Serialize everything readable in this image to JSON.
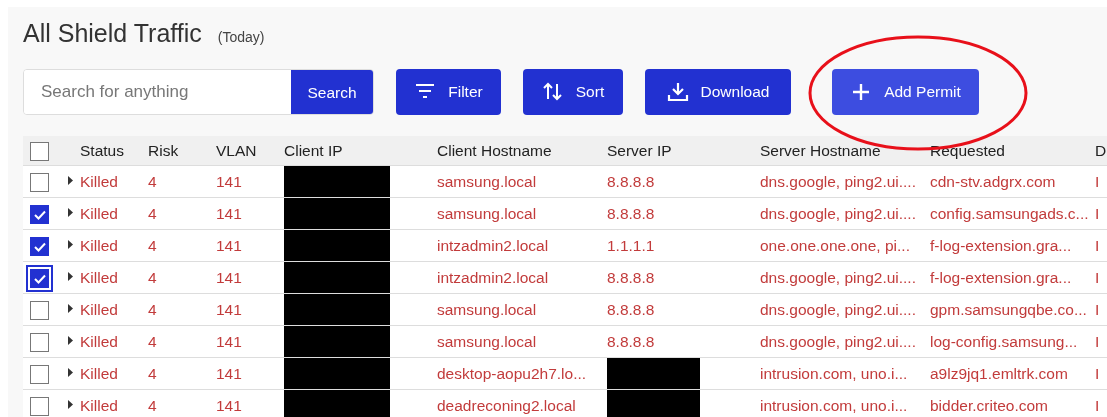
{
  "title": "All Shield Traffic",
  "subtitle": "(Today)",
  "search": {
    "placeholder": "Search for anything",
    "button": "Search"
  },
  "buttons": [
    {
      "label": "Filter",
      "kind": "filter",
      "hovered": false
    },
    {
      "label": "Sort",
      "kind": "sort",
      "hovered": false
    },
    {
      "label": "Download",
      "kind": "download",
      "hovered": false
    },
    {
      "label": "Add Permit",
      "kind": "add",
      "hovered": true
    }
  ],
  "annotation": {
    "kind": "ellipse",
    "color": "#e8101a"
  },
  "table": {
    "all_checked": false,
    "columns": [
      "Status",
      "Risk",
      "VLAN",
      "Client IP",
      "Client Hostname",
      "Server IP",
      "Server Hostname",
      "Requested",
      "D"
    ],
    "rows": [
      {
        "checked": false,
        "focused": false,
        "status": "Killed",
        "risk": "4",
        "vlan": "141",
        "client_ip_redacted": true,
        "client_hostname": "samsung.local",
        "server_ip": "8.8.8.8",
        "server_ip_redacted": false,
        "server_hostname": "dns.google, ping2.ui....",
        "requested": "cdn-stv.adgrx.com",
        "column_10": "I"
      },
      {
        "checked": true,
        "focused": false,
        "status": "Killed",
        "risk": "4",
        "vlan": "141",
        "client_ip_redacted": true,
        "client_hostname": "samsung.local",
        "server_ip": "8.8.8.8",
        "server_ip_redacted": false,
        "server_hostname": "dns.google, ping2.ui....",
        "requested": "config.samsungads.c...",
        "column_10": "I"
      },
      {
        "checked": true,
        "focused": false,
        "status": "Killed",
        "risk": "4",
        "vlan": "141",
        "client_ip_redacted": true,
        "client_hostname": "intzadmin2.local",
        "server_ip": "1.1.1.1",
        "server_ip_redacted": false,
        "server_hostname": "one.one.one.one, pi...",
        "requested": "f-log-extension.gra...",
        "column_10": "I"
      },
      {
        "checked": true,
        "focused": true,
        "status": "Killed",
        "risk": "4",
        "vlan": "141",
        "client_ip_redacted": true,
        "client_hostname": "intzadmin2.local",
        "server_ip": "8.8.8.8",
        "server_ip_redacted": false,
        "server_hostname": "dns.google, ping2.ui....",
        "requested": "f-log-extension.gra...",
        "column_10": "I"
      },
      {
        "checked": false,
        "focused": false,
        "status": "Killed",
        "risk": "4",
        "vlan": "141",
        "client_ip_redacted": true,
        "client_hostname": "samsung.local",
        "server_ip": "8.8.8.8",
        "server_ip_redacted": false,
        "server_hostname": "dns.google, ping2.ui....",
        "requested": "gpm.samsungqbe.co...",
        "column_10": "I"
      },
      {
        "checked": false,
        "focused": false,
        "status": "Killed",
        "risk": "4",
        "vlan": "141",
        "client_ip_redacted": true,
        "client_hostname": "samsung.local",
        "server_ip": "8.8.8.8",
        "server_ip_redacted": false,
        "server_hostname": "dns.google, ping2.ui....",
        "requested": "log-config.samsung...",
        "column_10": "I"
      },
      {
        "checked": false,
        "focused": false,
        "status": "Killed",
        "risk": "4",
        "vlan": "141",
        "client_ip_redacted": true,
        "client_hostname": "desktop-aopu2h7.lo...",
        "server_ip_redacted": true,
        "server_hostname": "intrusion.com, uno.i...",
        "requested": "a9lz9jq1.emltrk.com",
        "column_10": "I"
      },
      {
        "checked": false,
        "focused": false,
        "status": "Killed",
        "risk": "4",
        "vlan": "141",
        "client_ip_redacted": true,
        "client_hostname": "deadreconing2.local",
        "server_ip_redacted": true,
        "server_hostname": "intrusion.com, uno.i...",
        "requested": "bidder.criteo.com",
        "column_10": "I"
      }
    ]
  }
}
